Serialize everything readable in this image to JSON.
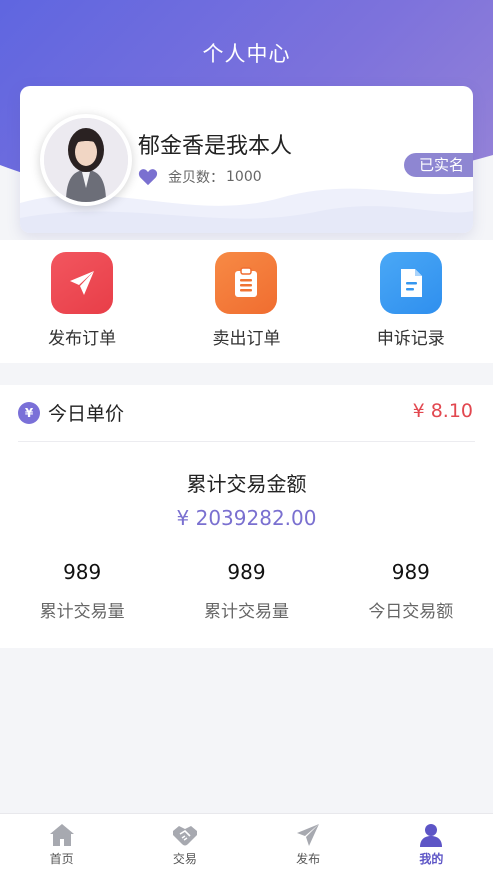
{
  "header": {
    "title": "个人中心"
  },
  "profile": {
    "name": "郁金香是我本人",
    "coins_label": "金贝数：",
    "coins_value": "1000",
    "verified_badge": "已实名",
    "avatar_icon": "avatar-photo"
  },
  "actions": [
    {
      "label": "发布订单",
      "icon": "paper-plane-icon",
      "color": "#ef4652"
    },
    {
      "label": "卖出订单",
      "icon": "clipboard-icon",
      "color": "#f47b3a"
    },
    {
      "label": "申诉记录",
      "icon": "document-icon",
      "color": "#3d9df2"
    }
  ],
  "stats": {
    "price_icon": "¥",
    "price_label": "今日单价",
    "price_value": "¥ 8.10",
    "total_label": "累计交易金额",
    "total_value": "¥ 2039282.00",
    "metrics": [
      {
        "value": "989",
        "label": "累计交易量"
      },
      {
        "value": "989",
        "label": "累计交易量"
      },
      {
        "value": "989",
        "label": "今日交易额"
      }
    ]
  },
  "tabbar": {
    "active_color": "#5d55c6",
    "items": [
      {
        "label": "首页",
        "icon": "home-icon",
        "active": false
      },
      {
        "label": "交易",
        "icon": "handshake-icon",
        "active": false
      },
      {
        "label": "发布",
        "icon": "send-icon",
        "active": false
      },
      {
        "label": "我的",
        "icon": "user-icon",
        "active": true
      }
    ]
  }
}
